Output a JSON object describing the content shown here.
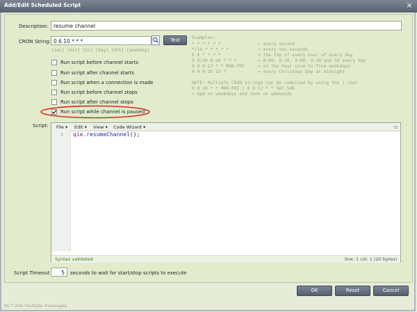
{
  "window": {
    "title": "Add/Edit Scheduled Script",
    "close_glyph": "×"
  },
  "description": {
    "label": "Description:",
    "value": "resume channel"
  },
  "cron": {
    "label": "CRON String:",
    "value": "0 6 10 * * *",
    "hint": "[sec] [min] [hr] [day] [mth] [weekday]",
    "test_label": "Test",
    "search_icon": "magnifier-icon"
  },
  "examples": {
    "heading": "Examples:",
    "rows": [
      {
        "expr": "* * * * * *",
        "desc": "= every second"
      },
      {
        "expr": "*/10 * * * * *",
        "desc": "= every ten seconds"
      },
      {
        "expr": "0 0 * * * *",
        "desc": "= the top of every hour of every day"
      },
      {
        "expr": "0 0/30 8-10 * * *",
        "desc": "= 8:00, 8:30, 9:00, 9:30 and 10 every day"
      },
      {
        "expr": "0 0 9-17 * * MON-FRI",
        "desc": "= on the hour nine-to-five weekdays"
      },
      {
        "expr": "0 0 0 25 12 ?",
        "desc": "= every Christmas Day at midnight"
      }
    ],
    "note1": "NOTE: Multiple CRON strings can be combined by using the | char",
    "note2": "0 0 18 * * MON-FRI | 0 0 12 * * SAT,SUN",
    "note3": "= 6pm on weekdays and noon on weekends"
  },
  "options": [
    {
      "label": "Run script before channel starts",
      "checked": false
    },
    {
      "label": "Run script after channel starts",
      "checked": false
    },
    {
      "label": "Run script when a connection is made",
      "checked": false
    },
    {
      "label": "Run script before channel stops",
      "checked": false
    },
    {
      "label": "Run script after channel stops",
      "checked": false
    },
    {
      "label": "Run script while channel is paused",
      "checked": true
    }
  ],
  "script": {
    "label": "Script:",
    "menus": [
      "File",
      "Edit",
      "View",
      "Code Wizard"
    ],
    "menu_arrow": "▾",
    "line_number": "1",
    "code_object": "qie",
    "code_method": ".resumeChannel",
    "code_parens": "()",
    "code_end": ";",
    "status_left": "Syntax validated",
    "status_right": "line: 1  col: 1  (20 bytes)",
    "maximize_glyph": "▫"
  },
  "timeout": {
    "label": "Script Timeout",
    "value": "5",
    "suffix": "seconds to wait for start/stop scripts to execute"
  },
  "buttons": {
    "ok": "OK",
    "reset": "Reset",
    "cancel": "Cancel"
  },
  "background_text": "HL7 into multiple messages",
  "colors": {
    "highlight_ellipse": "#d42a1f",
    "code_keyword": "#7a1a8a",
    "code_method": "#1c2aa8",
    "status_text": "#3a7a1a"
  }
}
